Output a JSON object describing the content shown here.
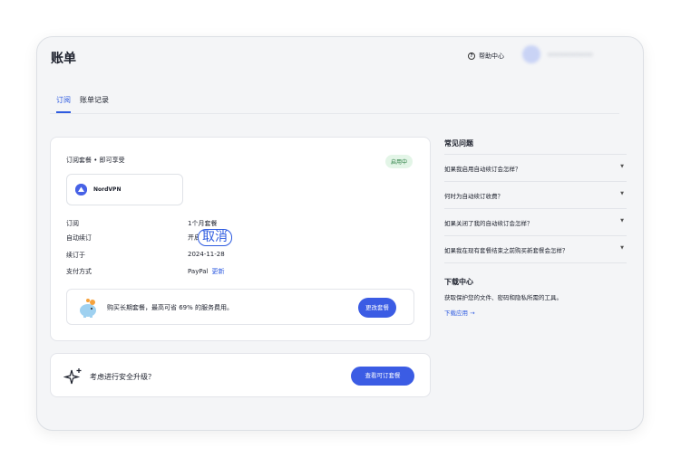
{
  "header": {
    "title": "账单",
    "help_label": "帮助中心",
    "help_icon": "?"
  },
  "tabs": [
    {
      "label": "订阅",
      "active": true
    },
    {
      "label": "账单记录",
      "active": false
    }
  ],
  "subscription": {
    "header": "订阅套餐 • 即可享受",
    "status": "启用中",
    "product": "NordVPN",
    "rows": [
      {
        "label": "订阅",
        "value": "1个月套餐"
      },
      {
        "label": "自动续订",
        "value": "开启"
      },
      {
        "label": "续订于",
        "value": "2024-11-28"
      },
      {
        "label": "支付方式",
        "value": "PayPal"
      }
    ],
    "cancel_label": "取消",
    "update_label": "更新",
    "promo_text": "购买长期套餐，最高可省 69% 的服务费用。",
    "change_plan_label": "更改套餐"
  },
  "security": {
    "text": "考虑进行安全升级？",
    "button_label": "查看可订套餐"
  },
  "faq": {
    "title": "常见问题",
    "items": [
      "如果我启用自动续订会怎样？",
      "何时为自动续订收费？",
      "如果关闭了我的自动续订会怎样？",
      "如果我在现有套餐结束之前购买新套餐会怎样？"
    ]
  },
  "download": {
    "title": "下载中心",
    "description": "获取保护您的文件、密码和隐私所需的工具。",
    "link_label": "下载应用 →"
  },
  "colors": {
    "accent": "#3b5ce4",
    "status_bg": "#e3f5e7",
    "status_text": "#237a3c"
  },
  "icons": [
    "question-circle-icon",
    "nordvpn-logo-icon",
    "piggy-bank-icon",
    "sparkle-icon",
    "chevron-down-icon"
  ]
}
